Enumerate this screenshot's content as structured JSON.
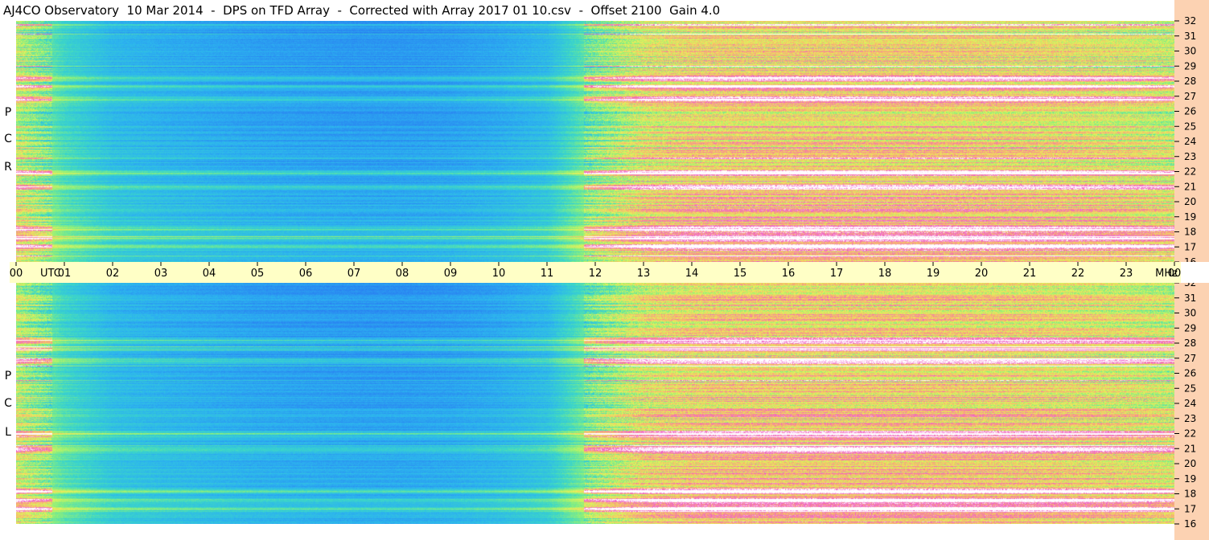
{
  "title": "AJ4CO Observatory  10 Mar 2014  -  DPS on TFD Array  -  Corrected with Array 2017 01 10.csv  -  Offset 2100  Gain 4.0",
  "panels": [
    {
      "label": [
        "R",
        "C",
        "P"
      ]
    },
    {
      "label": [
        "L",
        "C",
        "P"
      ]
    }
  ],
  "time_axis": {
    "ticks": [
      "00",
      "01",
      "02",
      "03",
      "04",
      "05",
      "06",
      "07",
      "08",
      "09",
      "10",
      "11",
      "12",
      "13",
      "14",
      "15",
      "16",
      "17",
      "18",
      "19",
      "20",
      "21",
      "22",
      "23",
      "00"
    ],
    "unit": "UTC"
  },
  "freq_axis": {
    "ticks": [
      "32",
      "31",
      "30",
      "29",
      "28",
      "27",
      "26",
      "25",
      "24",
      "23",
      "22",
      "21",
      "20",
      "19",
      "18",
      "17",
      "16"
    ],
    "unit": "MHz"
  },
  "colors": {
    "background": "#ffffff",
    "freq_strip": "#fcd2b2",
    "time_bar": "#ffffc6",
    "colormap": [
      "#1f5fe8",
      "#2a86f2",
      "#2cb4ef",
      "#3cd6c8",
      "#8ef07a",
      "#e8f05a",
      "#f8b070",
      "#f060c8",
      "#ffffff"
    ]
  },
  "chart_data": [
    {
      "type": "heatmap",
      "name": "RCP",
      "x": "UTC hour",
      "y": "frequency MHz",
      "xlim": [
        0,
        24
      ],
      "ylim": [
        16,
        32
      ],
      "intensity_profile_by_hour": [
        0.55,
        0.35,
        0.25,
        0.22,
        0.2,
        0.18,
        0.17,
        0.16,
        0.16,
        0.17,
        0.2,
        0.25,
        0.45,
        0.6,
        0.65,
        0.66,
        0.66,
        0.66,
        0.66,
        0.66,
        0.65,
        0.64,
        0.62,
        0.6,
        0.55
      ],
      "hot_bands_mhz": [
        17,
        17.6,
        18.2,
        21,
        22,
        26.8,
        27.6,
        28.2
      ]
    },
    {
      "type": "heatmap",
      "name": "LCP",
      "x": "UTC hour",
      "y": "frequency MHz",
      "xlim": [
        0,
        24
      ],
      "ylim": [
        16,
        32
      ],
      "intensity_profile_by_hour": [
        0.55,
        0.35,
        0.25,
        0.22,
        0.2,
        0.18,
        0.17,
        0.16,
        0.16,
        0.17,
        0.2,
        0.25,
        0.45,
        0.6,
        0.65,
        0.66,
        0.66,
        0.66,
        0.66,
        0.66,
        0.65,
        0.64,
        0.62,
        0.6,
        0.55
      ],
      "hot_bands_mhz": [
        17,
        17.6,
        18.2,
        21,
        22,
        26.8,
        27.6,
        28.2
      ]
    }
  ]
}
